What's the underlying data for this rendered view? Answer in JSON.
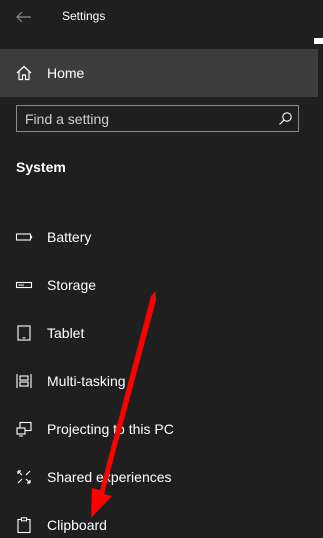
{
  "window": {
    "title": "Settings"
  },
  "icons": {
    "back": "back-arrow-icon",
    "home": "home-icon",
    "search": "search-icon",
    "battery": "battery-icon",
    "storage": "storage-icon",
    "tablet": "tablet-icon",
    "multitasking": "multitasking-icon",
    "projecting": "projecting-icon",
    "shared": "shared-experiences-icon",
    "clipboard": "clipboard-icon"
  },
  "nav": {
    "home_label": "Home",
    "search_placeholder": "Find a setting",
    "section_heading": "System",
    "items": [
      {
        "label": "Battery"
      },
      {
        "label": "Storage"
      },
      {
        "label": "Tablet"
      },
      {
        "label": "Multi-tasking"
      },
      {
        "label": "Projecting to this PC"
      },
      {
        "label": "Shared experiences"
      },
      {
        "label": "Clipboard"
      }
    ]
  },
  "colors": {
    "background": "#1f1f1f",
    "selected_row": "#3d3d3d",
    "search_border": "#8a8a8a",
    "text": "#ffffff",
    "annotation": "#ff0000"
  }
}
